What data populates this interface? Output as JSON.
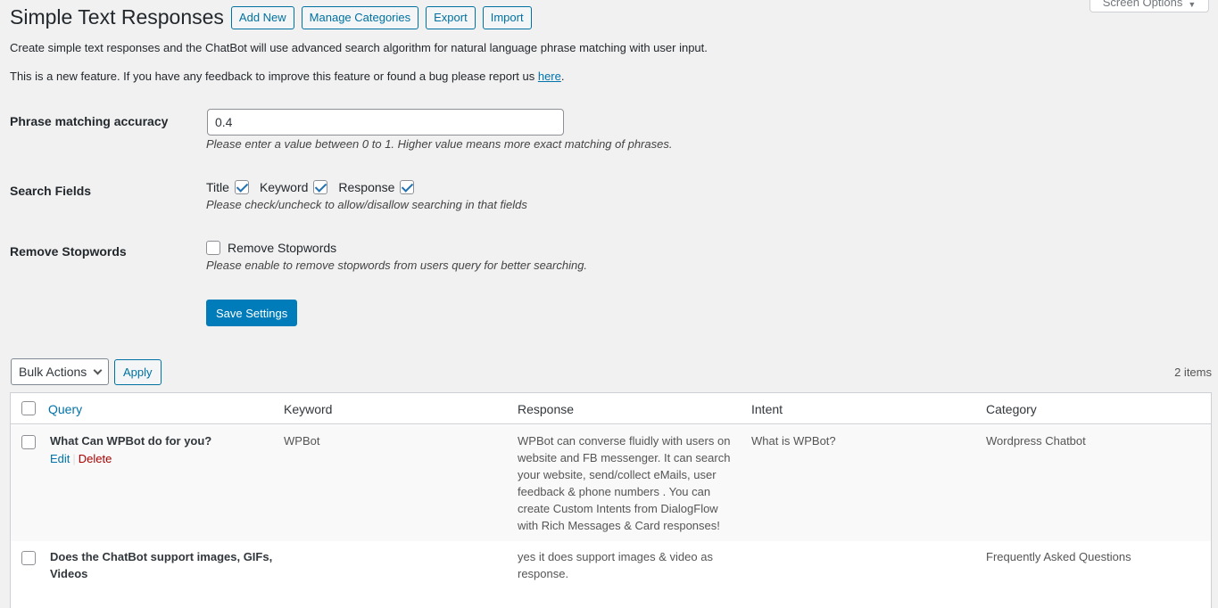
{
  "screen_options": {
    "label": "Screen Options"
  },
  "header": {
    "title": "Simple Text Responses",
    "buttons": [
      "Add New",
      "Manage Categories",
      "Export",
      "Import"
    ]
  },
  "intro": "Create simple text responses and the ChatBot will use advanced search algorithm for natural language phrase matching with user input.",
  "notice": {
    "text": "This is a new feature. If you have any feedback to improve this feature or found a bug please report us ",
    "link": "here",
    "suffix": "."
  },
  "settings": {
    "accuracy": {
      "label": "Phrase matching accuracy",
      "value": "0.4",
      "desc": "Please enter a value between 0 to 1. Higher value means more exact matching of phrases."
    },
    "search_fields": {
      "label": "Search Fields",
      "options": [
        {
          "label": "Title",
          "checked": true
        },
        {
          "label": "Keyword",
          "checked": true
        },
        {
          "label": "Response",
          "checked": true
        }
      ],
      "desc": "Please check/uncheck to allow/disallow searching in that fields"
    },
    "stopwords": {
      "label": "Remove Stopwords",
      "option_label": "Remove Stopwords",
      "checked": false,
      "desc": "Please enable to remove stopwords from users query for better searching."
    },
    "save_label": "Save Settings"
  },
  "table_nav": {
    "bulk_label": "Bulk Actions",
    "apply_label": "Apply",
    "count": "2 items"
  },
  "table": {
    "columns": [
      "Query",
      "Keyword",
      "Response",
      "Intent",
      "Category"
    ],
    "rows": [
      {
        "query": "What Can WPBot do for you?",
        "keyword": "WPBot",
        "response": "WPBot can converse fluidly with users on website and FB messenger. It can search your website, send/collect eMails, user feedback & phone numbers . You can create Custom Intents from DialogFlow with Rich Messages & Card responses!",
        "intent": "What is WPBot?",
        "category": "Wordpress Chatbot",
        "actions": {
          "edit": "Edit",
          "sep": "|",
          "delete": "Delete"
        }
      },
      {
        "query": "Does the ChatBot support images, GIFs, Videos",
        "keyword": "",
        "response": "yes it does support images & video as response.",
        "intent": "",
        "category": "Frequently Asked Questions"
      }
    ]
  }
}
